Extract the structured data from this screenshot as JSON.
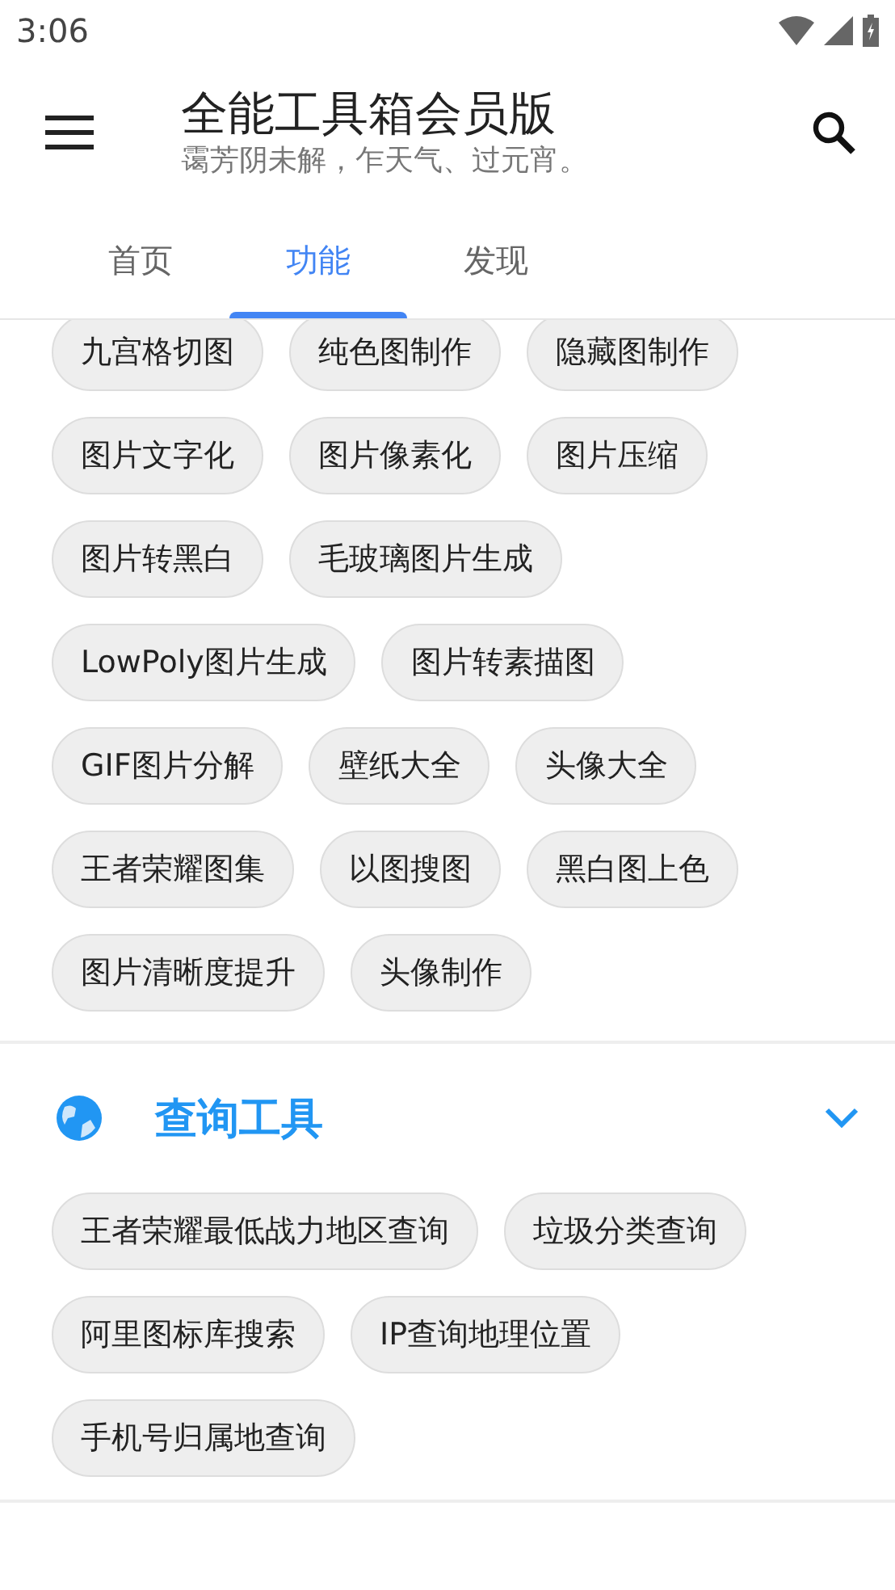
{
  "status_bar": {
    "time": "3:06"
  },
  "app_bar": {
    "title": "全能工具箱会员版",
    "subtitle": "霭芳阴未解，乍天气、过元宵。"
  },
  "tabs": [
    {
      "label": "首页",
      "selected": false
    },
    {
      "label": "功能",
      "selected": true
    },
    {
      "label": "发现",
      "selected": false
    }
  ],
  "sections": [
    {
      "chips": [
        "九宫格切图",
        "纯色图制作",
        "隐藏图制作",
        "图片文字化",
        "图片像素化",
        "图片压缩",
        "图片转黑白",
        "毛玻璃图片生成",
        "LowPoly图片生成",
        "图片转素描图",
        "GIF图片分解",
        "壁纸大全",
        "头像大全",
        "王者荣耀图集",
        "以图搜图",
        "黑白图上色",
        "图片清晰度提升",
        "头像制作"
      ]
    },
    {
      "title": "查询工具",
      "expanded": true,
      "chips": [
        "王者荣耀最低战力地区查询",
        "垃圾分类查询",
        "阿里图标库搜索",
        "IP查询地理位置",
        "手机号归属地查询"
      ]
    }
  ]
}
